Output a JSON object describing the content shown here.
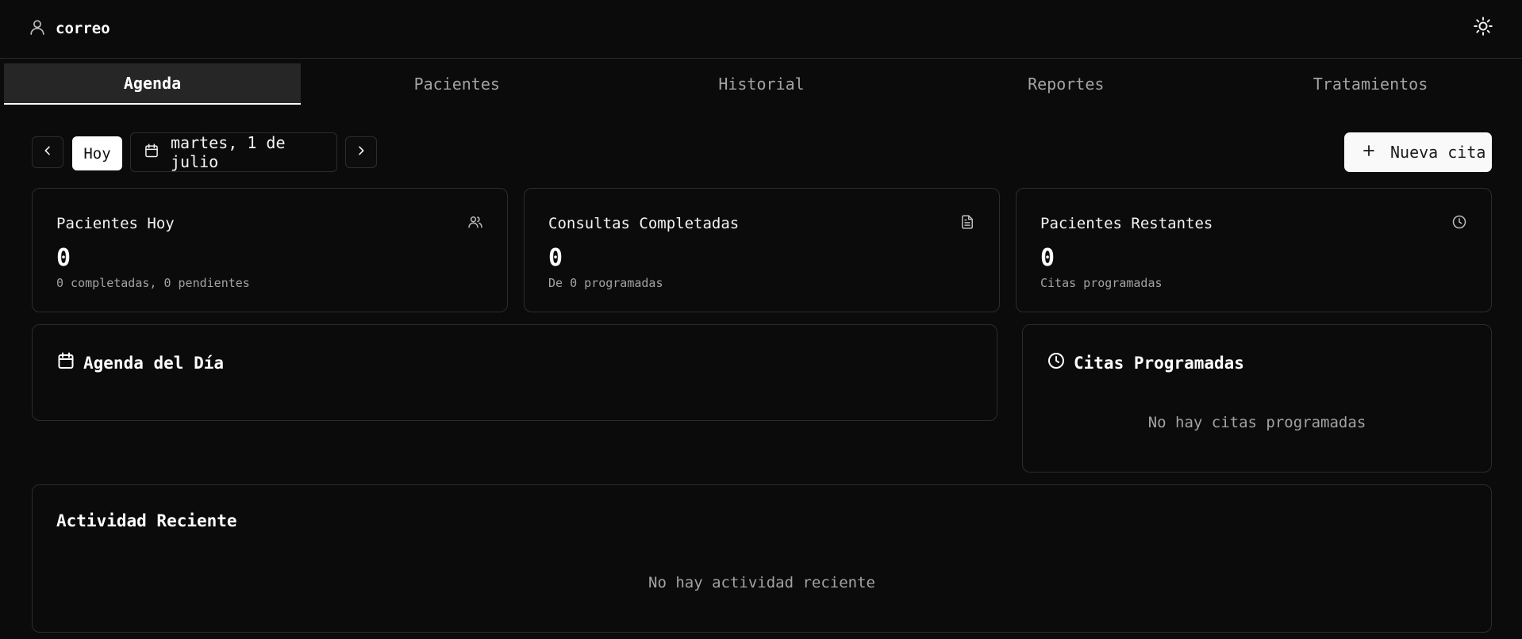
{
  "header": {
    "user_name": "correo",
    "user_icon": "user-icon",
    "theme_icon": "sun-icon"
  },
  "tabs": [
    {
      "label": "Agenda",
      "active": true
    },
    {
      "label": "Pacientes",
      "active": false
    },
    {
      "label": "Historial",
      "active": false
    },
    {
      "label": "Reportes",
      "active": false
    },
    {
      "label": "Tratamientos",
      "active": false
    }
  ],
  "toolbar": {
    "prev_icon": "chevron-left-icon",
    "today_label": "Hoy",
    "date_icon": "calendar-icon",
    "date_label": "martes, 1 de julio",
    "next_icon": "chevron-right-icon",
    "new_icon": "plus-icon",
    "new_label": "Nueva cita"
  },
  "stats": [
    {
      "title": "Pacientes Hoy",
      "value": "0",
      "sub": "0 completadas, 0 pendientes",
      "icon": "users-icon"
    },
    {
      "title": "Consultas Completadas",
      "value": "0",
      "sub": "De 0 programadas",
      "icon": "file-text-icon"
    },
    {
      "title": "Pacientes Restantes",
      "value": "0",
      "sub": "Citas programadas",
      "icon": "clock-icon"
    }
  ],
  "agenda": {
    "title": "Agenda del Día",
    "icon": "calendar-icon"
  },
  "scheduled": {
    "title": "Citas Programadas",
    "icon": "clock-icon",
    "empty": "No hay citas programadas"
  },
  "activity": {
    "title": "Actividad Reciente",
    "empty": "No hay actividad reciente"
  },
  "colors": {
    "background": "#0b0b0b",
    "border": "#2c2c2c",
    "muted_text": "#a3a3a3",
    "primary_button": "#f9f9f9"
  }
}
